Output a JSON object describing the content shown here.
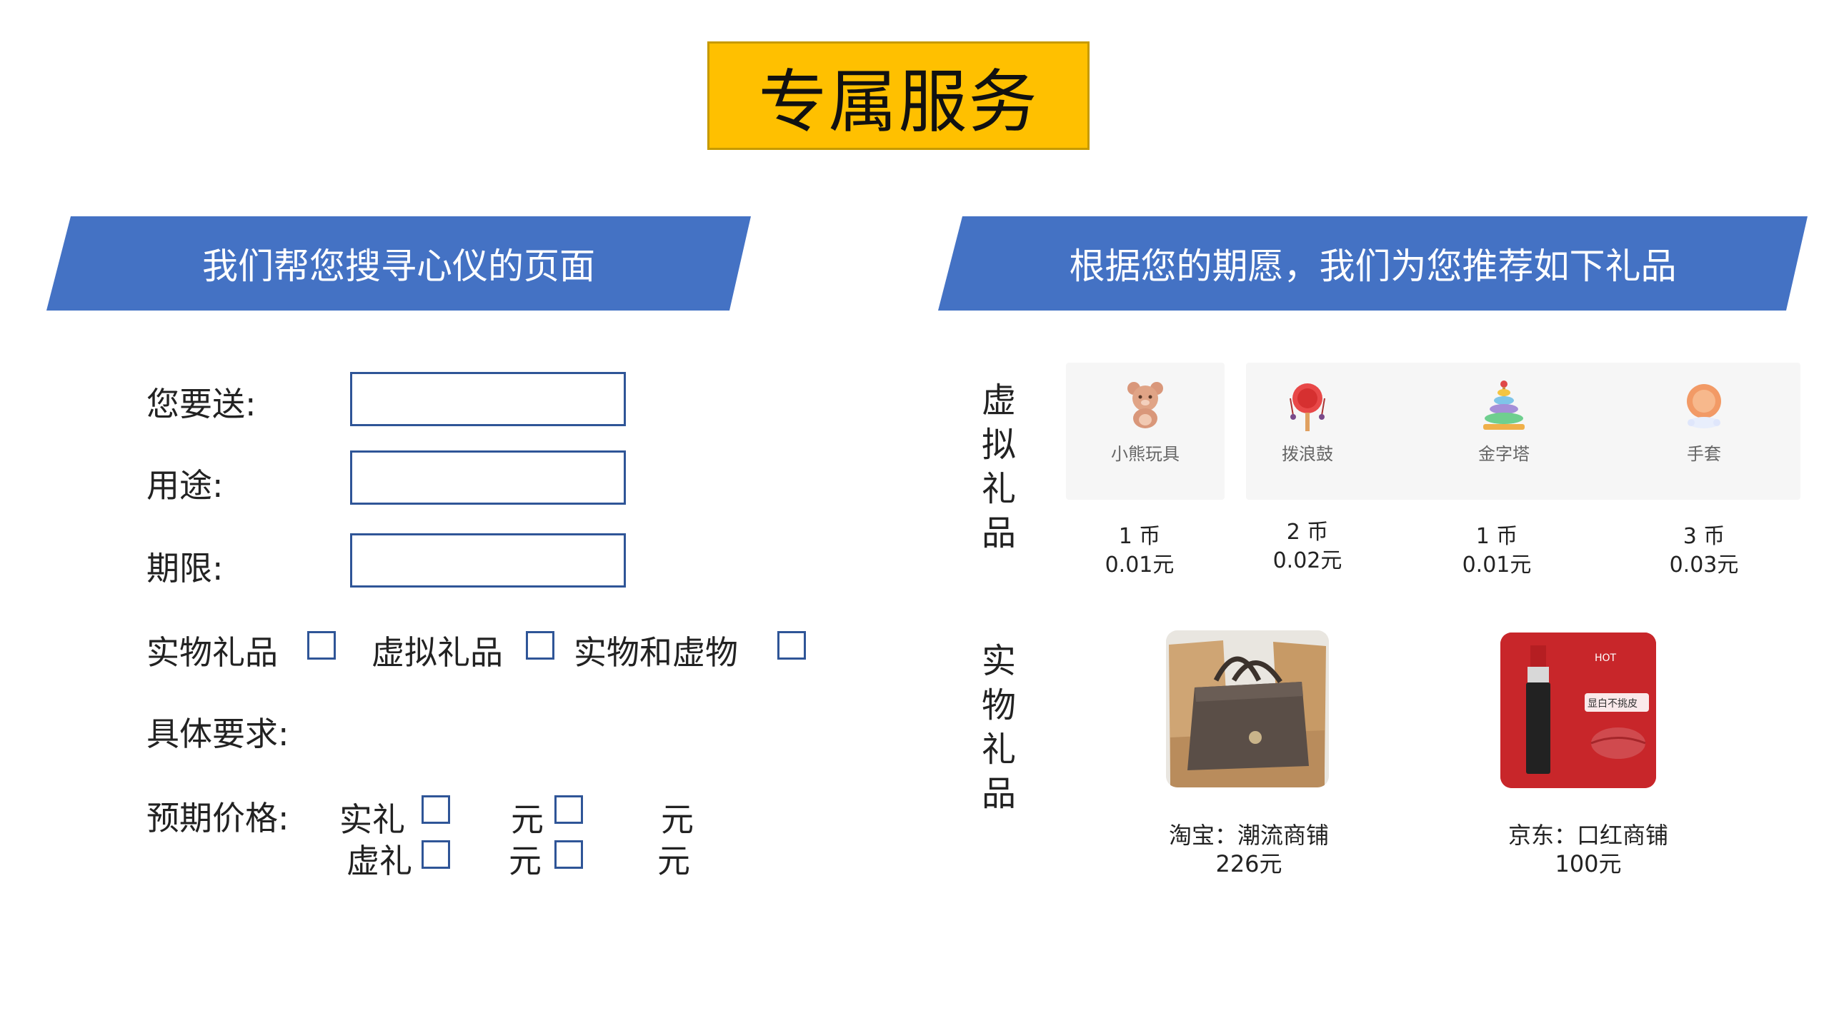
{
  "title": "专属服务",
  "left_banner": "我们帮您搜寻心仪的页面",
  "right_banner": "根据您的期愿，我们为您推荐如下礼品",
  "form": {
    "recipient_label": "您要送:",
    "purpose_label": "用途:",
    "deadline_label": "期限:",
    "type_physical": "实物礼品",
    "type_virtual": "虚拟礼品",
    "type_both": "实物和虚物",
    "requirements_label": "具体要求:",
    "price_label": "预期价格:",
    "real_gift": "实礼",
    "virtual_gift": "虚礼",
    "yuan": "元"
  },
  "virtual_section_label": [
    "虚",
    "拟",
    "礼",
    "品"
  ],
  "physical_section_label": [
    "实",
    "物",
    "礼",
    "品"
  ],
  "virtual_gifts": [
    {
      "name": "小熊玩具",
      "coins": "1 币",
      "price": "0.01元",
      "icon": "bear-icon"
    },
    {
      "name": "拨浪鼓",
      "coins": "2 币",
      "price": "0.02元",
      "icon": "rattle-drum-icon"
    },
    {
      "name": "金字塔",
      "coins": "1 币",
      "price": "0.01元",
      "icon": "stacking-rings-icon"
    },
    {
      "name": "手套",
      "coins": "3 币",
      "price": "0.03元",
      "icon": "glove-icon"
    }
  ],
  "physical_gifts": [
    {
      "shop": "淘宝：潮流商铺",
      "price": "226元",
      "image": "handbag-image"
    },
    {
      "shop": "京东：口红商铺",
      "price": "100元",
      "image": "lipstick-image",
      "badge": "HOT",
      "badge_text": "显白不挑皮"
    }
  ],
  "colors": {
    "accent_yellow": "#FFC000",
    "banner_blue": "#4472C4",
    "border_blue": "#2F5597"
  }
}
